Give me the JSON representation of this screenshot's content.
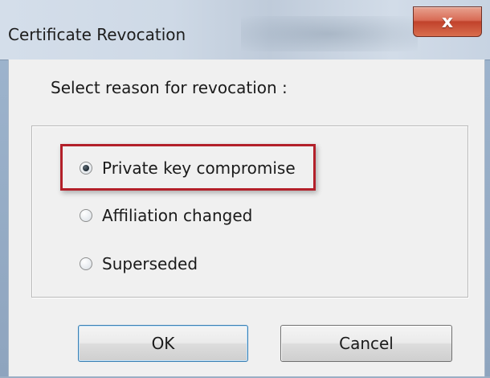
{
  "window": {
    "title": "Certificate Revocation",
    "close_label": "x"
  },
  "dialog": {
    "prompt": "Select reason for revocation :",
    "options": [
      {
        "label": "Private key compromise",
        "selected": true
      },
      {
        "label": "Affiliation changed",
        "selected": false
      },
      {
        "label": "Superseded",
        "selected": false
      }
    ],
    "highlight_color": "#b3202a",
    "buttons": {
      "ok_label": "OK",
      "cancel_label": "Cancel"
    }
  }
}
